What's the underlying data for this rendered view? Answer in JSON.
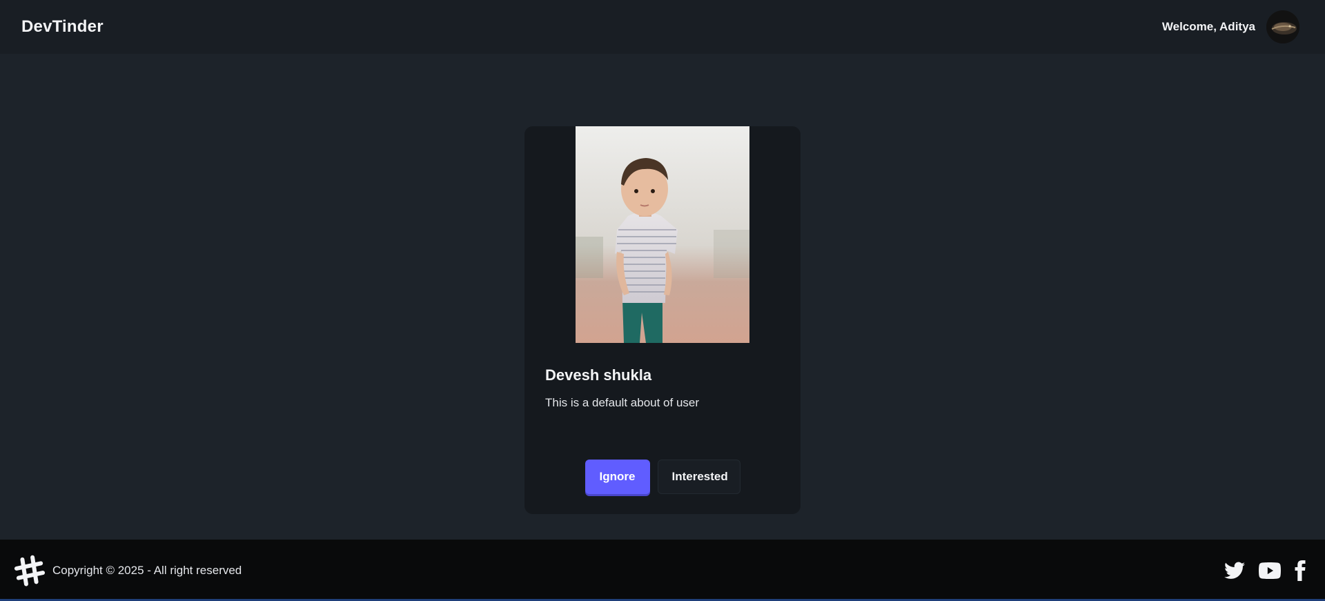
{
  "navbar": {
    "brand": "DevTinder",
    "welcome": "Welcome, Aditya",
    "avatar_icon": "user-avatar"
  },
  "card": {
    "name": "Devesh shukla",
    "about": "This is a default about of user",
    "photo": "child-photo",
    "ignore_label": "Ignore",
    "interested_label": "Interested"
  },
  "footer": {
    "copyright": "Copyright © 2025 - All right reserved",
    "logo_icon": "hashtag-icon",
    "socials": [
      "twitter-icon",
      "youtube-icon",
      "facebook-icon"
    ]
  },
  "colors": {
    "background": "#1d232a",
    "navbar": "#191e24",
    "card": "#15191e",
    "footer": "#090a0b",
    "primary": "#605dff"
  }
}
